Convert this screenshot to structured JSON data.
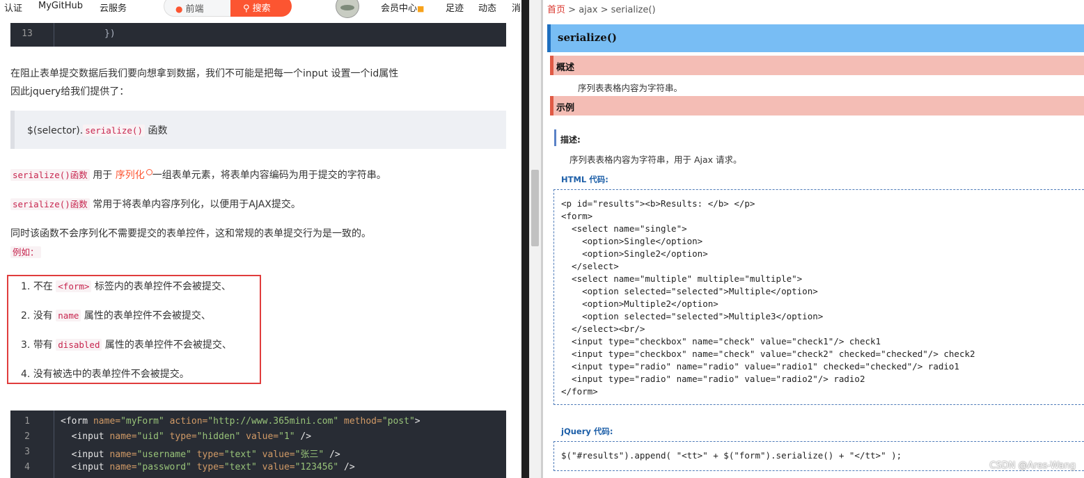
{
  "nav": {
    "items": [
      "认证",
      "MyGitHub",
      "云服务"
    ],
    "search_placeholder": "前端",
    "search_button": "搜索",
    "right_items": [
      "会员中心",
      "足迹",
      "动态",
      "消息"
    ]
  },
  "article": {
    "code_top": {
      "line": "13",
      "text": "})"
    },
    "p1": "在阻止表单提交数据后我们要向想拿到数据，我们不可能是把每一个input 设置一个id属性",
    "p2": "因此jquery给我们提供了：",
    "quote_prefix": "$(selector).",
    "quote_code": "serialize()",
    "quote_suffix": " 函数",
    "p3_code": "serialize()函数",
    "p3_a": " 用于 ",
    "p3_link": "序列化",
    "p3_b": "一组表单元素，将表单内容编码为用于提交的字符串。",
    "p4_code": "serialize()函数",
    "p4_text": " 常用于将表单内容序列化，以便用于AJAX提交。",
    "p5": "同时该函数不会序列化不需要提交的表单控件，这和常规的表单提交行为是一致的。",
    "p6": "例如：",
    "list": [
      {
        "num": "1. ",
        "pre": "不在 ",
        "code": "<form>",
        "post": " 标签内的表单控件不会被提交、"
      },
      {
        "num": "2. ",
        "pre": "没有 ",
        "code": "name",
        "post": " 属性的表单控件不会被提交、"
      },
      {
        "num": "3. ",
        "pre": "带有 ",
        "code": "disabled",
        "post": " 属性的表单控件不会被提交、"
      },
      {
        "num": "4. ",
        "pre": "没有被选中的表单控件不会被提交。",
        "code": "",
        "post": ""
      }
    ],
    "code_bottom": [
      {
        "n": "1",
        "text": "<form name=\"myForm\" action=\"http://www.365mini.com\" method=\"post\">"
      },
      {
        "n": "2",
        "text": "  <input name=\"uid\" type=\"hidden\" value=\"1\" />"
      },
      {
        "n": "3",
        "text": "  <input name=\"username\" type=\"text\" value=\"张三\" />"
      },
      {
        "n": "4",
        "text": "  <input name=\"password\" type=\"text\" value=\"123456\" />"
      }
    ]
  },
  "doc": {
    "crumb_home": "首页",
    "crumb_sep1": ">",
    "crumb_ajax": "ajax",
    "crumb_sep2": ">",
    "crumb_cur": "serialize()",
    "title": "serialize()",
    "overview_label": "概述",
    "overview_text": "序列表表格内容为字符串。",
    "example_label": "示例",
    "desc_label": "描述:",
    "desc_text": "序列表表格内容为字符串，用于 Ajax 请求。",
    "html_label": "HTML 代码:",
    "html_code": [
      "<p id=\"results\"><b>Results: </b> </p>",
      "<form>",
      "  <select name=\"single\">",
      "    <option>Single</option>",
      "    <option>Single2</option>",
      "  </select>",
      "  <select name=\"multiple\" multiple=\"multiple\">",
      "    <option selected=\"selected\">Multiple</option>",
      "    <option>Multiple2</option>",
      "    <option selected=\"selected\">Multiple3</option>",
      "  </select><br/>",
      "  <input type=\"checkbox\" name=\"check\" value=\"check1\"/> check1",
      "  <input type=\"checkbox\" name=\"check\" value=\"check2\" checked=\"checked\"/> check2",
      "  <input type=\"radio\" name=\"radio\" value=\"radio1\" checked=\"checked\"/> radio1",
      "  <input type=\"radio\" name=\"radio\" value=\"radio2\"/> radio2",
      "</form>"
    ],
    "jq_label": "jQuery 代码:",
    "jq_code": "$(\"#results\").append( \"<tt>\" + $(\"form\").serialize() + \"</tt>\" );",
    "watermark": "CSDN @Ares-Wang"
  }
}
